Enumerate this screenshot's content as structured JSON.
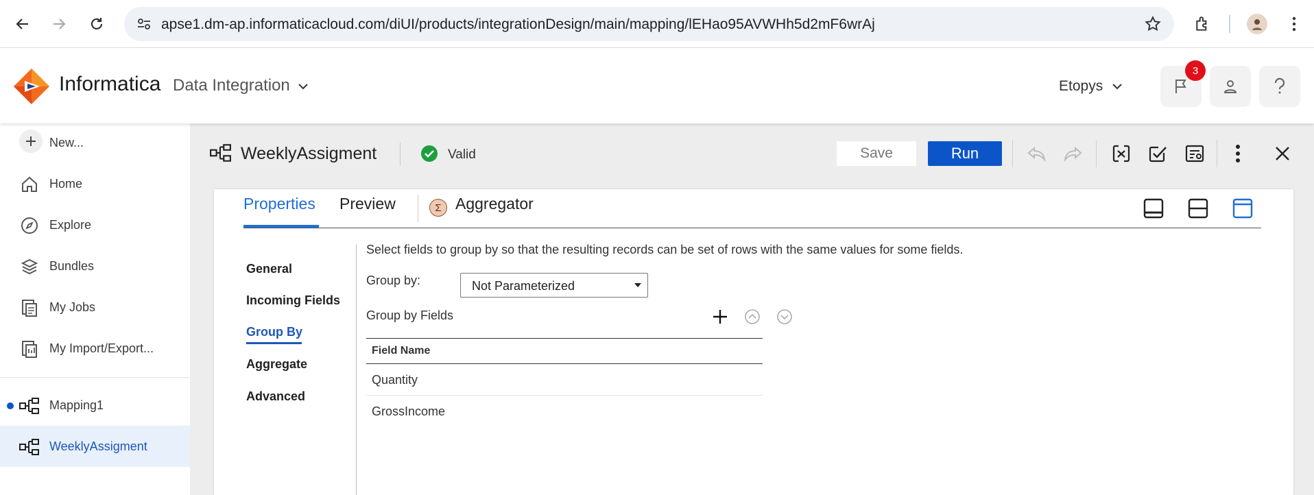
{
  "browser": {
    "url": "apse1.dm-ap.informaticacloud.com/diUI/products/integrationDesign/main/mapping/lEHao95AVWHh5d2mF6wrAj"
  },
  "header": {
    "brand": "Informatica",
    "product": "Data Integration",
    "org": "Etopys",
    "notification_count": "3"
  },
  "sidebar": {
    "new_label": "New...",
    "nav": [
      {
        "label": "Home",
        "icon": "home-icon"
      },
      {
        "label": "Explore",
        "icon": "compass-icon"
      },
      {
        "label": "Bundles",
        "icon": "layers-icon"
      },
      {
        "label": "My Jobs",
        "icon": "jobs-icon"
      },
      {
        "label": "My Import/Export..."
      }
    ],
    "open_assets": [
      {
        "label": "Mapping1",
        "unsaved": true
      },
      {
        "label": "WeeklyAssigment",
        "active": true
      }
    ]
  },
  "toolbar": {
    "asset_name": "WeeklyAssigment",
    "status": "Valid",
    "save_label": "Save",
    "run_label": "Run"
  },
  "panel": {
    "tabs": [
      "Properties",
      "Preview"
    ],
    "transformation_name": "Aggregator",
    "subnav": [
      "General",
      "Incoming Fields",
      "Group By",
      "Aggregate",
      "Advanced"
    ],
    "active_subnav": "Group By"
  },
  "group_by": {
    "description": "Select fields to group by so that the resulting records can be set of rows with the same values for some fields.",
    "label": "Group by:",
    "select_value": "Not Parameterized",
    "fields_label": "Group by Fields",
    "table": {
      "column": "Field Name",
      "rows": [
        "Quantity",
        "GrossIncome"
      ]
    }
  },
  "colors": {
    "primary": "#0b55c8",
    "tab_active": "#1f6fd6",
    "valid": "#1e9e3e",
    "badge": "#e0101b"
  }
}
